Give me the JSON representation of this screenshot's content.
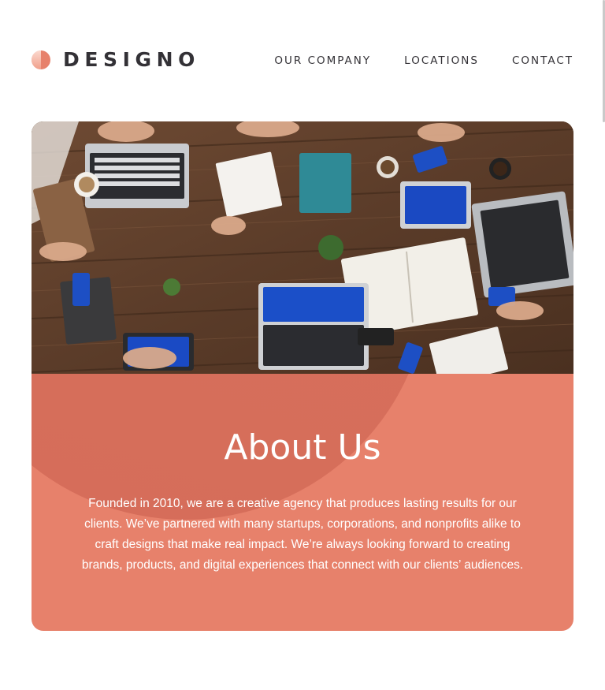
{
  "brand": {
    "name": "DESIGNO",
    "logo_icon": "half-circle-logo-icon"
  },
  "nav": {
    "items": [
      {
        "label": "OUR COMPANY"
      },
      {
        "label": "LOCATIONS"
      },
      {
        "label": "CONTACT"
      }
    ]
  },
  "hero": {
    "image_subject": "team-meeting-photo"
  },
  "about": {
    "title": "About Us",
    "body": "Founded in 2010, we are a creative agency that produces lasting results for our clients. We’ve partnered with many startups, corporations, and nonprofits alike to craft designs that make real impact. We’re always looking forward to creating brands, products, and digital experiences that connect with our clients’ audiences."
  },
  "colors": {
    "accent": "#E7816B",
    "accent_light": "#F4B3A2",
    "text_dark": "#333136",
    "white": "#FFFFFF"
  }
}
